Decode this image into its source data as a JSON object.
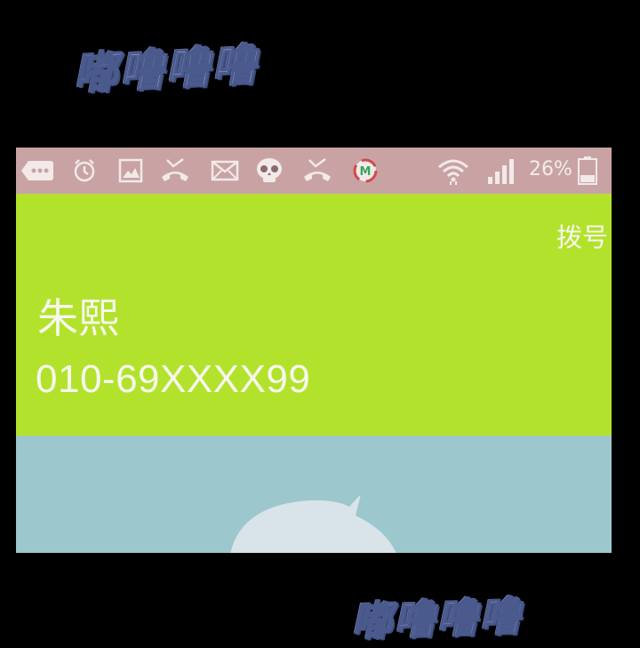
{
  "sfx": {
    "top": "嘟噜噜噜",
    "bottom": "嘟噜噜噜"
  },
  "status_bar": {
    "icons": [
      "more-notifications-icon",
      "alarm-icon",
      "gallery-icon",
      "missed-call-icon",
      "mail-icon",
      "skull-icon",
      "missed-call-icon",
      "app-m-icon",
      "wifi-icon",
      "signal-icon",
      "battery-icon"
    ],
    "battery_percent": "26%"
  },
  "call": {
    "status": "拨号",
    "name": "朱熙",
    "number": "010-69XXXX99"
  },
  "colors": {
    "statusbar_bg": "#c9a3a3",
    "call_panel_bg": "#b3e22c",
    "contact_area_bg": "#9cc7cc",
    "text": "#f6f8ee"
  }
}
